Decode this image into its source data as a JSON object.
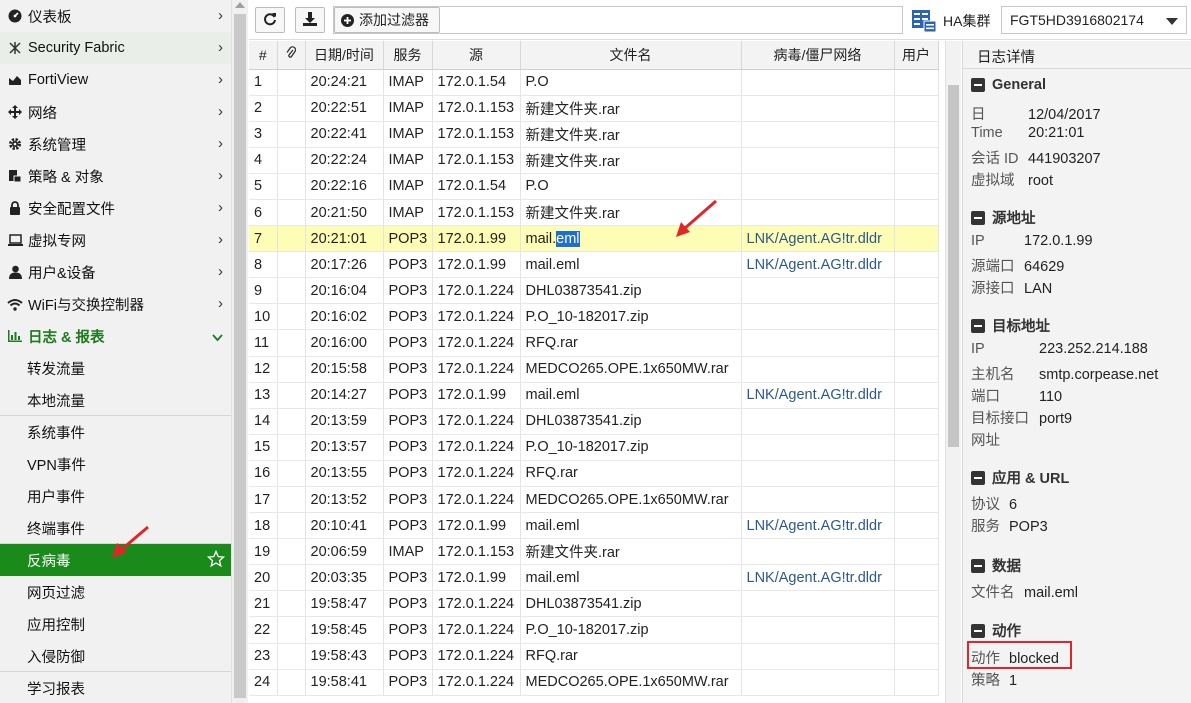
{
  "sidebar": {
    "items": [
      {
        "label": "仪表板",
        "icon": "dashboard-icon"
      },
      {
        "label": "Security Fabric",
        "icon": "security-fabric-icon"
      },
      {
        "label": "FortiView",
        "icon": "fortiview-icon"
      },
      {
        "label": "网络",
        "icon": "network-icon"
      },
      {
        "label": "系统管理",
        "icon": "gear-icon"
      },
      {
        "label": "策略 & 对象",
        "icon": "policy-icon"
      },
      {
        "label": "安全配置文件",
        "icon": "lock-icon"
      },
      {
        "label": "虚拟专网",
        "icon": "laptop-icon"
      },
      {
        "label": "用户&设备",
        "icon": "user-icon"
      },
      {
        "label": "WiFi与交换控制器",
        "icon": "wifi-icon"
      },
      {
        "label": "日志 & 报表",
        "icon": "bar-chart-icon"
      }
    ],
    "subitems": [
      "转发流量",
      "本地流量",
      "系统事件",
      "VPN事件",
      "用户事件",
      "终端事件",
      "反病毒",
      "网页过滤",
      "应用控制",
      "入侵防御",
      "学习报表"
    ],
    "selected_subitem": "反病毒"
  },
  "toolbar": {
    "add_filter": "添加过滤器",
    "ha_label": "HA集群",
    "ha_value": "FGT5HD3916802174"
  },
  "table": {
    "headers": [
      "#",
      "",
      "日期/时间",
      "服务",
      "源",
      "文件名",
      "病毒/僵尸网络",
      "用户"
    ],
    "rows": [
      [
        "1",
        "20:24:21",
        "IMAP",
        "172.0.1.54",
        "P.O",
        ""
      ],
      [
        "2",
        "20:22:51",
        "IMAP",
        "172.0.1.153",
        "新建文件夹.rar",
        ""
      ],
      [
        "3",
        "20:22:41",
        "IMAP",
        "172.0.1.153",
        "新建文件夹.rar",
        ""
      ],
      [
        "4",
        "20:22:24",
        "IMAP",
        "172.0.1.153",
        "新建文件夹.rar",
        ""
      ],
      [
        "5",
        "20:22:16",
        "IMAP",
        "172.0.1.54",
        "P.O",
        ""
      ],
      [
        "6",
        "20:21:50",
        "IMAP",
        "172.0.1.153",
        "新建文件夹.rar",
        ""
      ],
      [
        "7",
        "20:21:01",
        "POP3",
        "172.0.1.99",
        "mail.eml",
        "LNK/Agent.AG!tr.dldr"
      ],
      [
        "8",
        "20:17:26",
        "POP3",
        "172.0.1.99",
        "mail.eml",
        "LNK/Agent.AG!tr.dldr"
      ],
      [
        "9",
        "20:16:04",
        "POP3",
        "172.0.1.224",
        "DHL03873541.zip",
        ""
      ],
      [
        "10",
        "20:16:02",
        "POP3",
        "172.0.1.224",
        "P.O_10-182017.zip",
        ""
      ],
      [
        "11",
        "20:16:00",
        "POP3",
        "172.0.1.224",
        "RFQ.rar",
        ""
      ],
      [
        "12",
        "20:15:58",
        "POP3",
        "172.0.1.224",
        "MEDCO265.OPE.1x650MW.rar",
        ""
      ],
      [
        "13",
        "20:14:27",
        "POP3",
        "172.0.1.99",
        "mail.eml",
        "LNK/Agent.AG!tr.dldr"
      ],
      [
        "14",
        "20:13:59",
        "POP3",
        "172.0.1.224",
        "DHL03873541.zip",
        ""
      ],
      [
        "15",
        "20:13:57",
        "POP3",
        "172.0.1.224",
        "P.O_10-182017.zip",
        ""
      ],
      [
        "16",
        "20:13:55",
        "POP3",
        "172.0.1.224",
        "RFQ.rar",
        ""
      ],
      [
        "17",
        "20:13:52",
        "POP3",
        "172.0.1.224",
        "MEDCO265.OPE.1x650MW.rar",
        ""
      ],
      [
        "18",
        "20:10:41",
        "POP3",
        "172.0.1.99",
        "mail.eml",
        "LNK/Agent.AG!tr.dldr"
      ],
      [
        "19",
        "20:06:59",
        "IMAP",
        "172.0.1.153",
        "新建文件夹.rar",
        ""
      ],
      [
        "20",
        "20:03:35",
        "POP3",
        "172.0.1.99",
        "mail.eml",
        "LNK/Agent.AG!tr.dldr"
      ],
      [
        "21",
        "19:58:47",
        "POP3",
        "172.0.1.224",
        "DHL03873541.zip",
        ""
      ],
      [
        "22",
        "19:58:45",
        "POP3",
        "172.0.1.224",
        "P.O_10-182017.zip",
        ""
      ],
      [
        "23",
        "19:58:43",
        "POP3",
        "172.0.1.224",
        "RFQ.rar",
        ""
      ],
      [
        "24",
        "19:58:41",
        "POP3",
        "172.0.1.224",
        "MEDCO265.OPE.1x650MW.rar",
        ""
      ]
    ],
    "highlighted_row": "7",
    "selected_text_prefix": "mail.",
    "selected_text": "eml"
  },
  "details": {
    "title": "日志详情",
    "general": {
      "title": "General",
      "date_k": "日",
      "date_v": "12/04/2017",
      "time_k": "Time",
      "time_v": "20:21:01",
      "session_k": "会话 ID",
      "session_v": "441903207",
      "vdom_k": "虚拟域",
      "vdom_v": "root"
    },
    "source": {
      "title": "源地址",
      "ip_k": "IP",
      "ip_v": "172.0.1.99",
      "port_k": "源端口",
      "port_v": "64629",
      "intf_k": "源接口",
      "intf_v": "LAN"
    },
    "dest": {
      "title": "目标地址",
      "ip_k": "IP",
      "ip_v": "223.252.214.188",
      "host_k": "主机名",
      "host_v": "smtp.corpease.net",
      "port_k": "端口",
      "port_v": "110",
      "intf_k": "目标接口",
      "intf_v": "port9",
      "url_k": "网址"
    },
    "app": {
      "title": "应用 & URL",
      "proto_k": "协议",
      "proto_v": "6",
      "svc_k": "服务",
      "svc_v": "POP3"
    },
    "data": {
      "title": "数据",
      "file_k": "文件名",
      "file_v": "mail.eml"
    },
    "action": {
      "title": "动作",
      "action_k": "动作",
      "action_v": "blocked",
      "policy_k": "策略",
      "policy_v": "1"
    }
  },
  "colors": {
    "accent_green": "#1a8a1a",
    "highlight_row": "#fdfdb5",
    "annotation_red": "#e0262b",
    "link_blue": "#2b5a8a"
  }
}
